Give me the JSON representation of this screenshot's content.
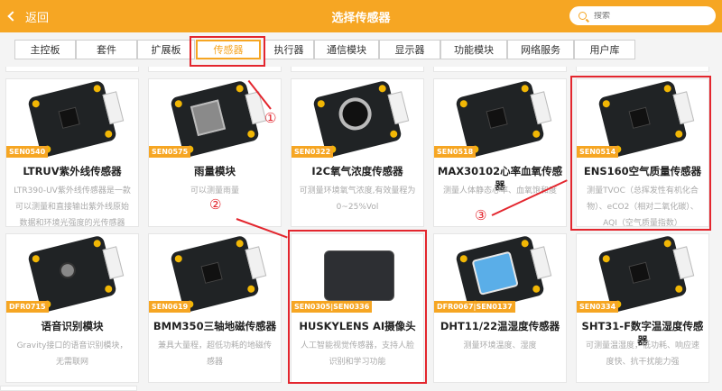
{
  "header": {
    "back_label": "返回",
    "title": "选择传感器",
    "search_placeholder": "搜索"
  },
  "tabs": [
    {
      "label": "主控板"
    },
    {
      "label": "套件"
    },
    {
      "label": "扩展板"
    },
    {
      "label": "传感器",
      "active": true
    },
    {
      "label": "执行器"
    },
    {
      "label": "通信模块"
    },
    {
      "label": "显示器"
    },
    {
      "label": "功能模块"
    },
    {
      "label": "网络服务"
    },
    {
      "label": "用户库"
    }
  ],
  "cards": [
    {
      "sku": "SEN0540",
      "title": "LTRUV紫外线传感器",
      "desc": "LTR390-UV紫外线传感器是一款可以测量和直接输出紫外线原始数据和环境光强度的光传感器"
    },
    {
      "sku": "SEN0575",
      "title": "雨量模块",
      "desc": "可以测量雨量"
    },
    {
      "sku": "SEN0322",
      "title": "I2C氧气浓度传感器",
      "desc": "可测量环境氧气浓度,有效量程为0~25%Vol"
    },
    {
      "sku": "SEN0518",
      "title": "MAX30102心率血氧传感器",
      "desc": "测量人体静态心率、血氧饱和度"
    },
    {
      "sku": "SEN0514",
      "title": "ENS160空气质量传感器",
      "desc": "测量TVOC（总挥发性有机化合物）、eCO2（相对二氧化碳）、AQI（空气质量指数）"
    },
    {
      "sku": "DFR0715",
      "title": "语音识别模块",
      "desc": "Gravity接口的语音识别模块，无需联网"
    },
    {
      "sku": "SEN0619",
      "title": "BMM350三轴地磁传感器",
      "desc": "兼具大量程，超低功耗的地磁传感器"
    },
    {
      "sku": "SEN0305|SEN0336",
      "title": "HUSKYLENS AI摄像头",
      "desc": "人工智能视觉传感器，支持人脸识别和学习功能"
    },
    {
      "sku": "DFR0067|SEN0137",
      "title": "DHT11/22温湿度传感器",
      "desc": "测量环境温度、湿度"
    },
    {
      "sku": "SEN0334",
      "title": "SHT31-F数字温湿度传感器",
      "desc": "可测量温湿度，低功耗、响应速度快、抗干扰能力强"
    }
  ],
  "annotations": {
    "n1": "①",
    "n2": "②",
    "n3": "③"
  },
  "colors": {
    "accent": "#f6a623",
    "highlight": "#e3262e"
  }
}
